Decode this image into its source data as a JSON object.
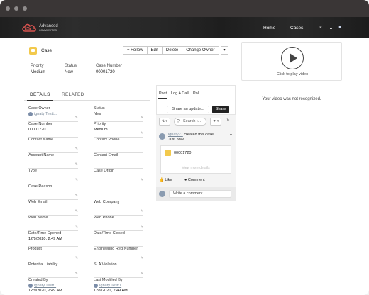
{
  "window": {
    "dots": [
      "#8f8c8c",
      "#8f8c8c",
      "#8f8c8c"
    ]
  },
  "nav": {
    "logo_text_1": "Advanced",
    "logo_text_2": "COMMUNITIES",
    "home": "Home",
    "cases": "Cases",
    "search_icon": "⌕",
    "bell_icon": "▲",
    "avatar_icon": "●"
  },
  "record": {
    "object_label": "Case",
    "buttons": {
      "follow": "+ Follow",
      "edit": "Edit",
      "delete": "Delete",
      "change_owner": "Change Owner",
      "more": "▾"
    },
    "highlights": [
      {
        "label": "Priority",
        "value": "Medium"
      },
      {
        "label": "Status",
        "value": "New"
      },
      {
        "label": "Case Number",
        "value": "00001720"
      }
    ]
  },
  "tabs": {
    "details": "DETAILS",
    "related": "RELATED"
  },
  "details": {
    "case_owner": {
      "label": "Case Owner",
      "value": "ignaty Testt..."
    },
    "status": {
      "label": "Status",
      "value": "New"
    },
    "case_number": {
      "label": "Case Number",
      "value": "00001720"
    },
    "priority": {
      "label": "Priority",
      "value": "Medium"
    },
    "contact_name": {
      "label": "Contact Name",
      "value": ""
    },
    "contact_phone": {
      "label": "Contact Phone",
      "value": ""
    },
    "account_name": {
      "label": "Account Name",
      "value": ""
    },
    "contact_email": {
      "label": "Contact Email",
      "value": ""
    },
    "type": {
      "label": "Type",
      "value": ""
    },
    "case_origin": {
      "label": "Case Origin",
      "value": ""
    },
    "case_reason": {
      "label": "Case Reason",
      "value": ""
    },
    "web_email": {
      "label": "Web Email",
      "value": ""
    },
    "web_company": {
      "label": "Web Company",
      "value": ""
    },
    "web_name": {
      "label": "Web Name",
      "value": ""
    },
    "web_phone": {
      "label": "Web Phone",
      "value": ""
    },
    "date_opened": {
      "label": "Date/Time Opened",
      "value": "12/9/2020, 2:49 AM"
    },
    "date_closed": {
      "label": "Date/Time Closed",
      "value": ""
    },
    "product": {
      "label": "Product",
      "value": ""
    },
    "engineering_req": {
      "label": "Engineering Req Number",
      "value": ""
    },
    "potential_liability": {
      "label": "Potential Liability",
      "value": ""
    },
    "sla_violation": {
      "label": "SLA Violation",
      "value": ""
    },
    "created_by": {
      "label": "Created By",
      "user": "Ignaty Testt1",
      "value": "12/9/2020, 2:49 AM"
    },
    "modified_by": {
      "label": "Last Modified By",
      "user": "Ignaty Testt1",
      "value": "12/9/2020, 2:49 AM"
    }
  },
  "feed": {
    "publisher_tabs": [
      "Post",
      "Log A Call",
      "Poll"
    ],
    "share_input": "Share an update...",
    "share_button": "Share",
    "sort_icon": "⇅ ▾",
    "search_placeholder": "Search t...",
    "filter_icon": "▼ ▾",
    "refresh_icon": "↻",
    "post_user": "ignaty27",
    "post_text": " created this case.",
    "post_time": "Just now",
    "case_number": "00001720",
    "view_more": "View more details",
    "like": "Like",
    "comment": "Comment",
    "comment_placeholder": "Write a comment..."
  },
  "video": {
    "caption": "Click to play video",
    "error": "Your video was not recognized."
  }
}
